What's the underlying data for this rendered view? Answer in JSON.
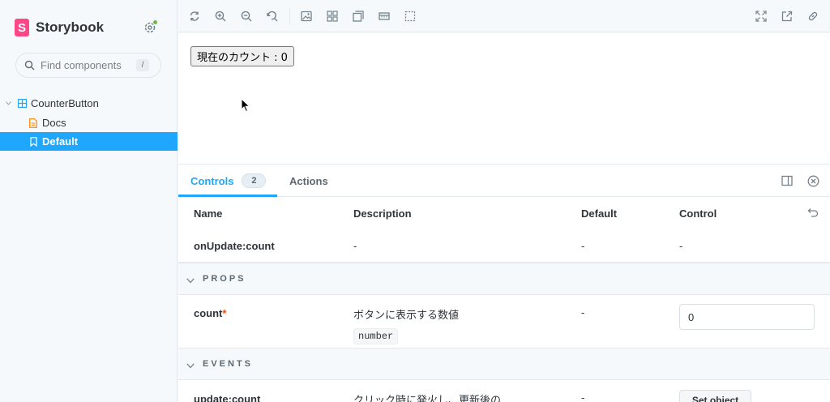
{
  "sidebar": {
    "brand": "Storybook",
    "logo_letter": "S",
    "search_placeholder": "Find components",
    "search_shortcut": "/",
    "tree": {
      "group": "CounterButton",
      "docs": "Docs",
      "story": "Default"
    }
  },
  "toolbar": {
    "icons": [
      "reload-icon",
      "zoom-in-icon",
      "zoom-out-icon",
      "zoom-reset-icon",
      "background-icon",
      "grid-icon",
      "viewport-icon",
      "ruler-icon",
      "outline-icon",
      "fullscreen-icon",
      "open-new-tab-icon",
      "copy-link-icon"
    ]
  },
  "canvas": {
    "button_label": "現在のカウント : 0"
  },
  "panel": {
    "tabs": {
      "controls": "Controls",
      "controls_count": "2",
      "actions": "Actions"
    },
    "columns": {
      "name": "Name",
      "description": "Description",
      "default": "Default",
      "control": "Control"
    },
    "rows": {
      "on_update": {
        "name": "onUpdate:count",
        "description": "-",
        "default": "-",
        "control": "-"
      },
      "count": {
        "name": "count",
        "required": "*",
        "description": "ボタンに表示する数値",
        "type": "number",
        "default": "-",
        "value": "0"
      },
      "update_count": {
        "name": "update:count",
        "description": "クリック時に発火し、更新後の",
        "default": "-",
        "control_label": "Set object"
      }
    },
    "sections": {
      "props": "PROPS",
      "events": "EVENTS"
    }
  },
  "colors": {
    "accent": "#1ea7fd",
    "brand": "#ff4785",
    "required": "#ff4400",
    "status_ok": "#66bf3c"
  }
}
